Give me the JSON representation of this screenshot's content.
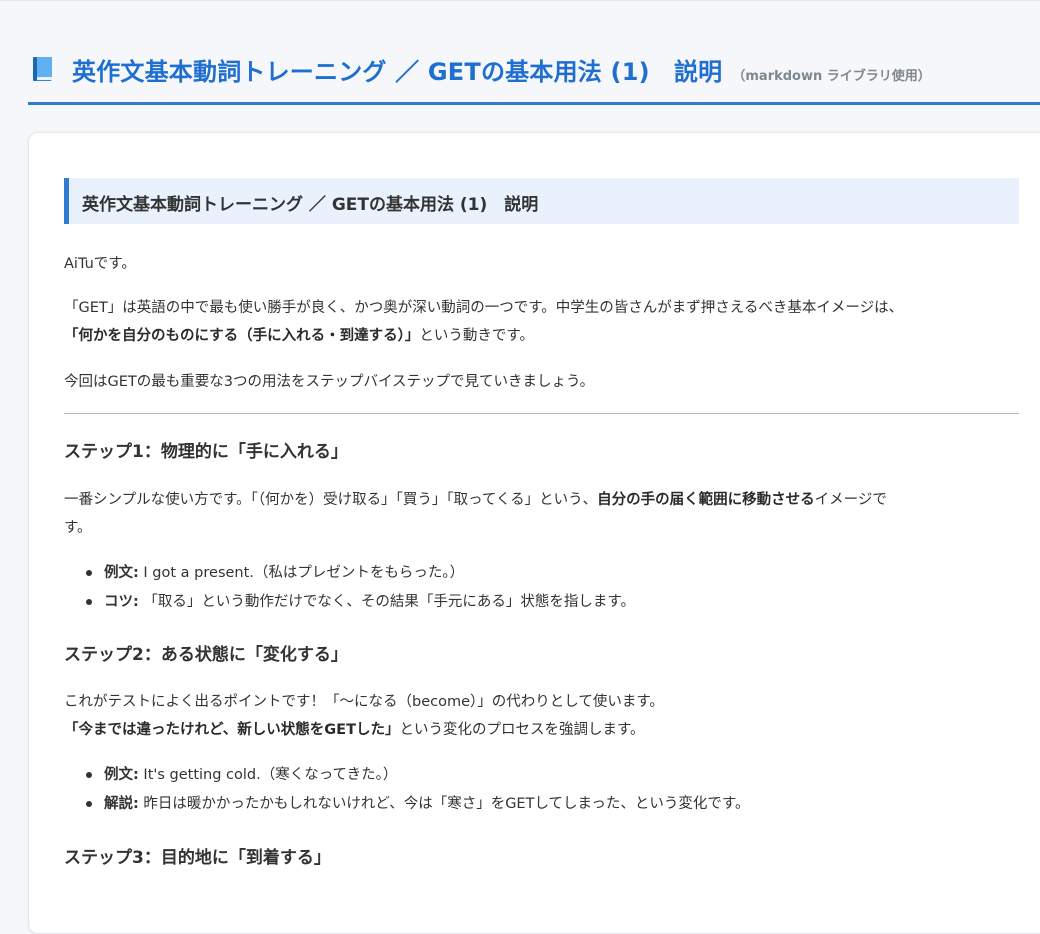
{
  "page": {
    "title": "英作文基本動詞トレーニング ／ GETの基本用法 (1)　説明",
    "subtitle": "（markdown ライブラリ使用）",
    "icon": "book-icon"
  },
  "doc": {
    "heading": "英作文基本動詞トレーニング ／ GETの基本用法 (1)　説明",
    "intro": "AiTuです。",
    "para1_line1": "「GET」は英語の中で最も使い勝手が良く、かつ奥が深い動詞の一つです。中学生の皆さんがまず押さえるべき基本イメージは、",
    "para1_bold": "「何かを自分のものにする（手に入れる・到達する）」",
    "para1_tail": "という動きです。",
    "para2": "今回はGETの最も重要な3つの用法をステップバイステップで見ていきましょう。",
    "step1": {
      "heading": "ステップ1：物理的に「手に入れる」",
      "text_pre": "一番シンプルな使い方です。「（何かを）受け取る」「買う」「取ってくる」という、",
      "text_bold": "自分の手の届く範囲に移動させる",
      "text_post": "イメージで",
      "text_wrap": "す。",
      "bullets": [
        {
          "label": "例文:",
          "text": " I got a present.（私はプレゼントをもらった。）"
        },
        {
          "label": "コツ:",
          "text": " 「取る」という動作だけでなく、その結果「手元にある」状態を指します。"
        }
      ]
    },
    "step2": {
      "heading": "ステップ2：ある状態に「変化する」",
      "text_line1": "これがテストによく出るポイントです！「〜になる（become）」の代わりとして使います。",
      "text_bold": "「今までは違ったけれど、新しい状態をGETした」",
      "text_tail": "という変化のプロセスを強調します。",
      "bullets": [
        {
          "label": "例文:",
          "text": " It's getting cold.（寒くなってきた。）"
        },
        {
          "label": "解説:",
          "text": " 昨日は暖かかったかもしれないけれど、今は「寒さ」をGETしてしまった、という変化です。"
        }
      ]
    },
    "step3": {
      "heading": "ステップ3：目的地に「到着する」"
    }
  }
}
